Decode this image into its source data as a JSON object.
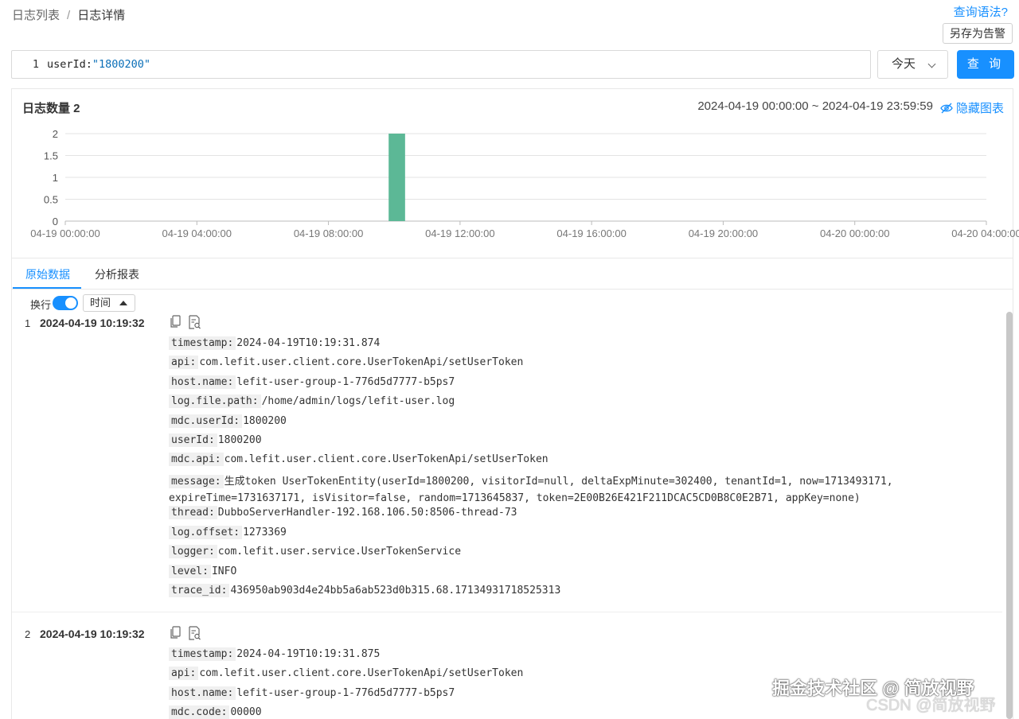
{
  "breadcrumb": {
    "parent": "日志列表",
    "separator": "/",
    "current": "日志详情"
  },
  "header": {
    "syntax_link": "查询语法?",
    "save_alert": "另存为告警"
  },
  "query": {
    "line_no": "1",
    "key": "userId:",
    "value": "\"1800200\""
  },
  "date_select": {
    "value": "今天"
  },
  "search_button": "查 询",
  "stats": {
    "log_count_label": "日志数量 2",
    "time_range": "2024-04-19 00:00:00 ~ 2024-04-19 23:59:59",
    "hide_chart": "隐藏图表"
  },
  "chart_data": {
    "type": "bar",
    "x_tick_labels": [
      "04-19 00:00:00",
      "04-19 04:00:00",
      "04-19 08:00:00",
      "04-19 12:00:00",
      "04-19 16:00:00",
      "04-19 20:00:00",
      "04-20 00:00:00",
      "04-20 04:00:00"
    ],
    "y_tick_labels": [
      "2",
      "1.5",
      "1",
      "0.5",
      "0"
    ],
    "ylim": [
      0,
      2
    ],
    "xlim_hours": [
      0,
      28
    ],
    "bars": [
      {
        "start_hour": 9.83,
        "end_hour": 10.33,
        "value": 2
      }
    ],
    "bar_color": "#5cb896",
    "grid": true
  },
  "tabs": [
    {
      "label": "原始数据",
      "active": true
    },
    {
      "label": "分析报表",
      "active": false
    }
  ],
  "controls": {
    "wrap_label": "换行",
    "sort_label": "时间"
  },
  "records": [
    {
      "index": "1",
      "time": "2024-04-19 10:19:32",
      "fields": [
        {
          "k": "timestamp:",
          "v": "2024-04-19T10:19:31.874"
        },
        {
          "k": "api:",
          "v": "com.lefit.user.client.core.UserTokenApi/setUserToken"
        },
        {
          "k": "host.name:",
          "v": "lefit-user-group-1-776d5d7777-b5ps7"
        },
        {
          "k": "log.file.path:",
          "v": "/home/admin/logs/lefit-user.log"
        },
        {
          "k": "mdc.userId:",
          "v": "1800200"
        },
        {
          "k": "userId:",
          "v": "1800200"
        },
        {
          "k": "mdc.api:",
          "v": "com.lefit.user.client.core.UserTokenApi/setUserToken"
        },
        {
          "k": "message:",
          "v": "生成token UserTokenEntity(userId=1800200, visitorId=null, deltaExpMinute=302400, tenantId=1, now=1713493171, expireTime=1731637171, isVisitor=false, random=1713645837, token=2E00B26E421F211DCAC5CD0B8C0E2B71, appKey=none)"
        },
        {
          "k": "thread:",
          "v": "DubboServerHandler-192.168.106.50:8506-thread-73"
        },
        {
          "k": "log.offset:",
          "v": "1273369"
        },
        {
          "k": "logger:",
          "v": "com.lefit.user.service.UserTokenService"
        },
        {
          "k": "level:",
          "v": "INFO"
        },
        {
          "k": "trace_id:",
          "v": "436950ab903d4e24bb5a6ab523d0b315.68.17134931718525313"
        }
      ]
    },
    {
      "index": "2",
      "time": "2024-04-19 10:19:32",
      "fields": [
        {
          "k": "timestamp:",
          "v": "2024-04-19T10:19:31.875"
        },
        {
          "k": "api:",
          "v": "com.lefit.user.client.core.UserTokenApi/setUserToken"
        },
        {
          "k": "host.name:",
          "v": "lefit-user-group-1-776d5d7777-b5ps7"
        },
        {
          "k": "mdc.code:",
          "v": "00000"
        }
      ]
    }
  ],
  "watermarks": {
    "primary": "掘金技术社区 @ 简放视野",
    "secondary": "CSDN @简放视野"
  }
}
